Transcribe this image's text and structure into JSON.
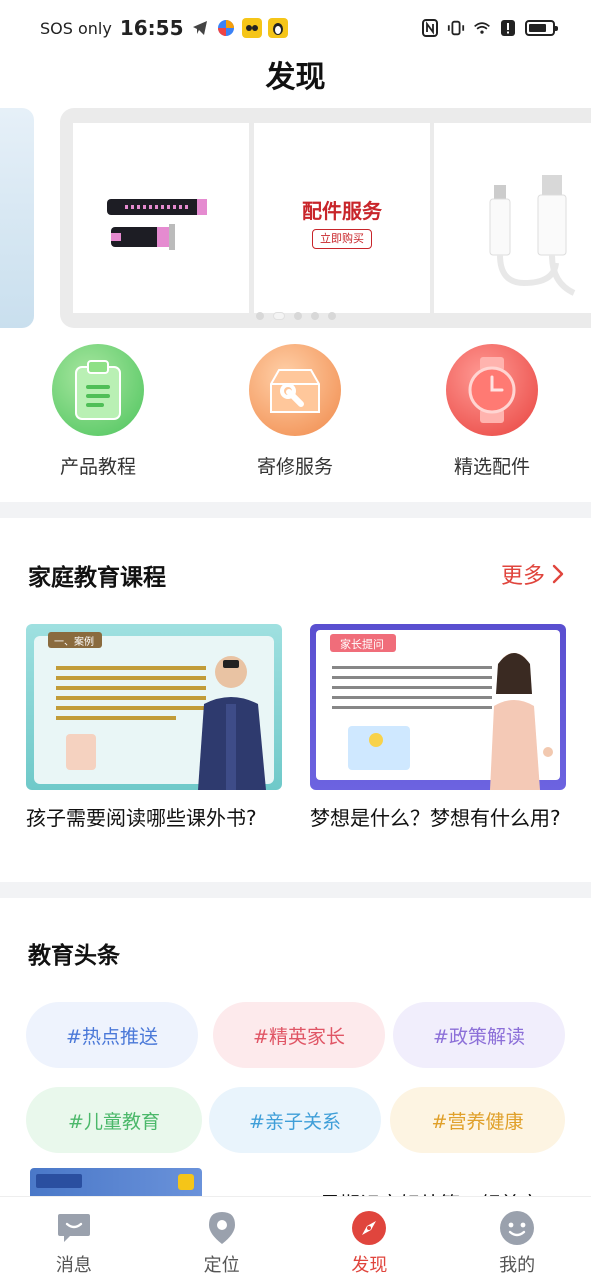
{
  "status_bar": {
    "sos": "SOS only",
    "time": "16:55"
  },
  "title": "发现",
  "banner": {
    "center_title": "配件服务",
    "center_button": "立即购买"
  },
  "quick_actions": [
    {
      "label": "产品教程"
    },
    {
      "label": "寄修服务"
    },
    {
      "label": "精选配件"
    }
  ],
  "family_course": {
    "title": "家庭教育课程",
    "more_label": "更多",
    "courses": [
      {
        "title": "孩子需要阅读哪些课外书?",
        "badge": "一、案例"
      },
      {
        "title": "梦想是什么？梦想有什么用?",
        "badge": "家长提问"
      }
    ]
  },
  "news": {
    "title": "教育头条",
    "tags": [
      "#热点推送",
      "#精英家长",
      "#政策解读",
      "#儿童教育",
      "#亲子关系",
      "#营养健康"
    ],
    "peek_title": "早期识字好处等一领首字"
  },
  "nav": [
    {
      "label": "消息"
    },
    {
      "label": "定位"
    },
    {
      "label": "发现"
    },
    {
      "label": "我的"
    }
  ],
  "colors": {
    "accent": "#e0453d",
    "divider": "#f2f3f5"
  }
}
